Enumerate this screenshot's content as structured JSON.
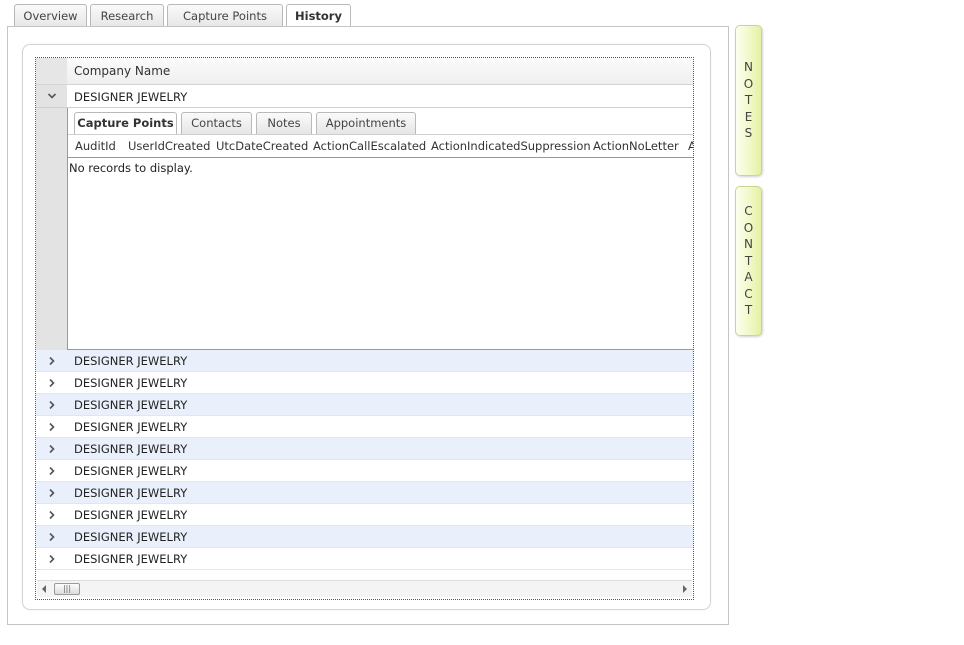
{
  "top_tabs": [
    {
      "label": "Overview",
      "active": false
    },
    {
      "label": "Research",
      "active": false
    },
    {
      "label": "Capture Points",
      "active": false
    },
    {
      "label": "History",
      "active": true
    }
  ],
  "grid": {
    "column_header": "Company Name",
    "expanded_row": {
      "company": "DESIGNER JEWELRY",
      "sub_tabs": [
        {
          "label": "Capture Points",
          "active": true
        },
        {
          "label": "Contacts",
          "active": false
        },
        {
          "label": "Notes",
          "active": false
        },
        {
          "label": "Appointments",
          "active": false
        }
      ],
      "sub_columns": [
        "AuditId",
        "UserIdCreated",
        "UtcDateCreated",
        "ActionCallEscalated",
        "ActionIndicatedSuppression",
        "ActionNoLetter",
        "A"
      ],
      "empty_message": "No records to display."
    },
    "rows": [
      "DESIGNER JEWELRY",
      "DESIGNER JEWELRY",
      "DESIGNER JEWELRY",
      "DESIGNER JEWELRY",
      "DESIGNER JEWELRY",
      "DESIGNER JEWELRY",
      "DESIGNER JEWELRY",
      "DESIGNER JEWELRY",
      "DESIGNER JEWELRY",
      "DESIGNER JEWELRY"
    ],
    "scroll_thumb_glyph": "|||"
  },
  "side_tabs": {
    "notes": "NOTES",
    "contact": "CONTACT"
  },
  "colors": {
    "alt_row": "#e9f0fb",
    "side_tab": "#f1f8c8"
  }
}
